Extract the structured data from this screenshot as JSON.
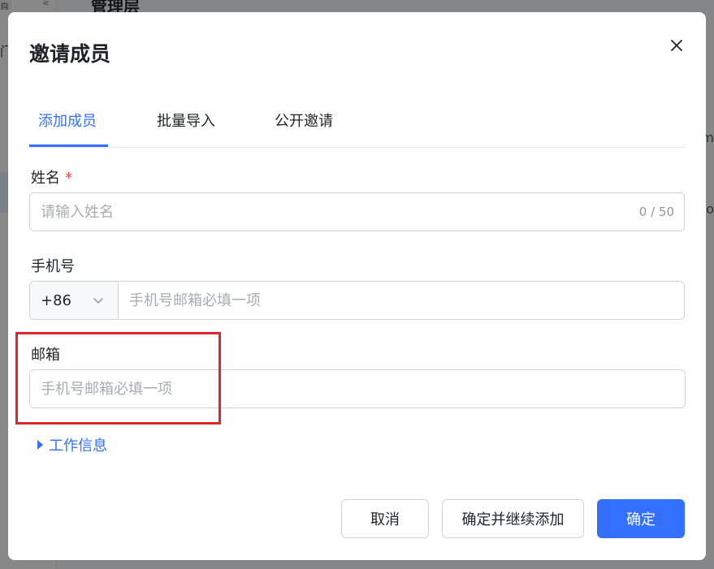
{
  "background": {
    "title": "管理层",
    "left_tag": "自",
    "left_glyph": "门"
  },
  "modal": {
    "title": "邀请成员",
    "close_icon": "close-icon"
  },
  "tabs": [
    {
      "label": "添加成员",
      "active": true
    },
    {
      "label": "批量导入",
      "active": false
    },
    {
      "label": "公开邀请",
      "active": false
    }
  ],
  "form": {
    "name": {
      "label": "姓名",
      "required_mark": "*",
      "placeholder": "请输入姓名",
      "value": "",
      "counter": "0 / 50"
    },
    "phone": {
      "label": "手机号",
      "country_code": "+86",
      "placeholder": "手机号邮箱必填一项",
      "value": ""
    },
    "email": {
      "label": "邮箱",
      "placeholder": "手机号邮箱必填一项",
      "value": ""
    },
    "work_info": {
      "label": "工作信息"
    }
  },
  "buttons": {
    "cancel": "取消",
    "confirm_continue": "确定并继续添加",
    "confirm": "确定"
  },
  "colors": {
    "accent": "#3370ff",
    "highlight": "#e0262c",
    "required": "#f54a45"
  }
}
